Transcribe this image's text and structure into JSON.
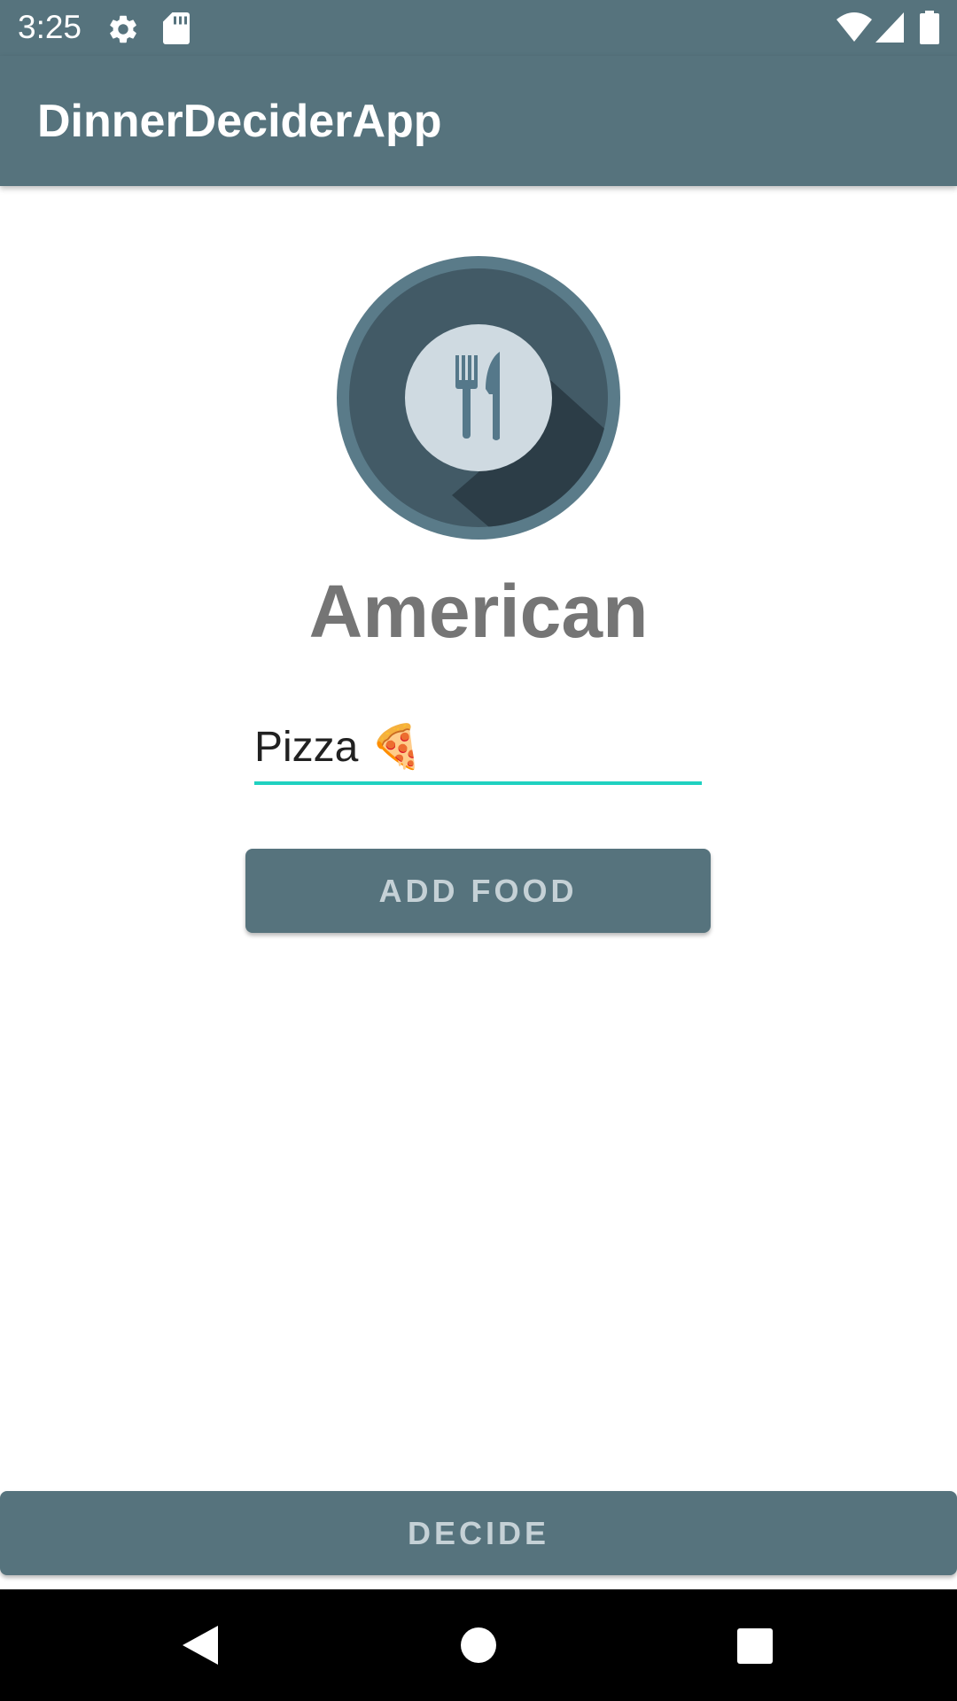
{
  "status_bar": {
    "time": "3:25",
    "icons": [
      "gear-icon",
      "sd-card-icon",
      "wifi-icon",
      "signal-icon",
      "battery-icon"
    ]
  },
  "app_bar": {
    "title": "DinnerDeciderApp"
  },
  "main": {
    "logo_icon": "fork-knife-plate-icon",
    "cuisine": "American",
    "food_input_value": "Pizza 🍕",
    "add_food_label": "ADD FOOD"
  },
  "bottom": {
    "decide_label": "DECIDE"
  },
  "nav_bar": {
    "icons": [
      "back-icon",
      "home-icon",
      "recents-icon"
    ]
  },
  "colors": {
    "primary": "#56737d",
    "accent": "#1fd1c0",
    "label_text": "#757575",
    "button_text": "#c5d1d6"
  }
}
